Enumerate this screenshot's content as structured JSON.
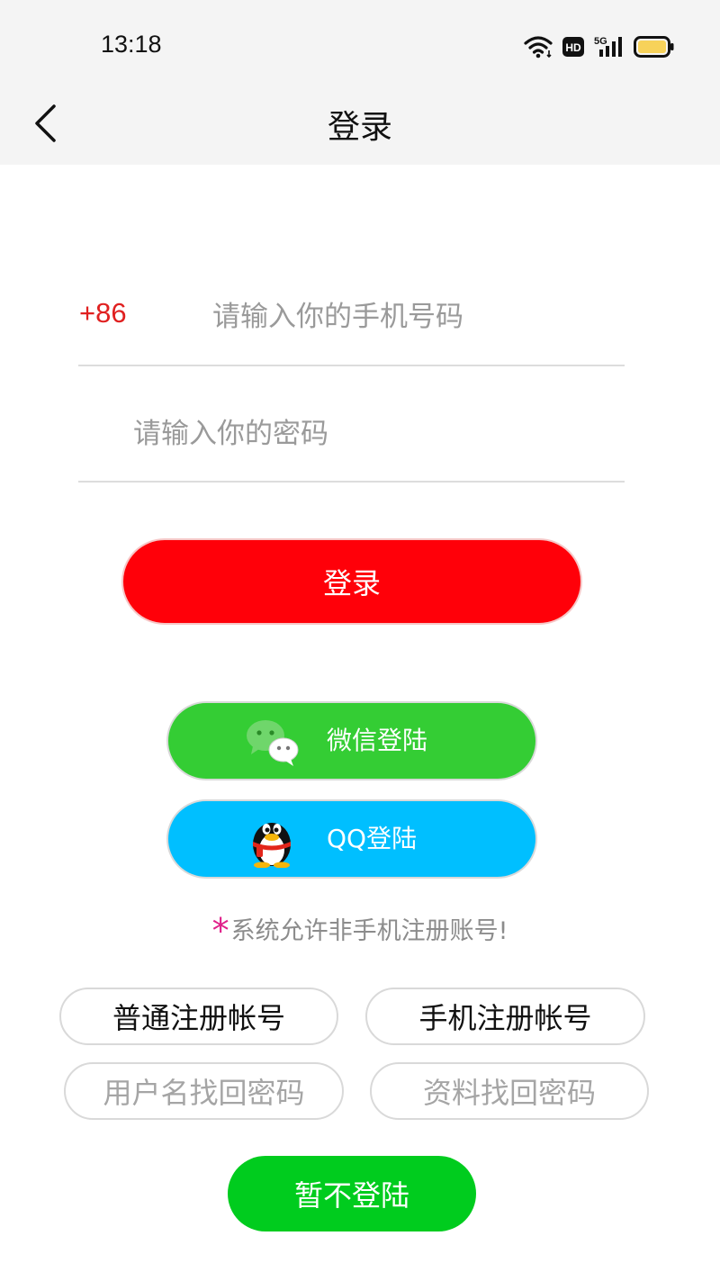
{
  "status_bar": {
    "time": "13:18",
    "hd_label": "HD",
    "network_label": "5G",
    "icons": [
      "wifi-icon",
      "hd-icon",
      "signal-5g-icon",
      "battery-icon"
    ],
    "battery_color": "#f7d25a"
  },
  "nav": {
    "title": "登录",
    "back_icon": "chevron-left-icon"
  },
  "form": {
    "phone_prefix": "+86",
    "phone_placeholder": "请输入你的手机号码",
    "phone_value": "",
    "password_placeholder": "请输入你的密码",
    "password_value": "",
    "login_label": "登录"
  },
  "social": {
    "wechat_label": "微信登陆",
    "qq_label": "QQ登陆"
  },
  "notice": {
    "star": "*",
    "text": "系统允许非手机注册账号!"
  },
  "links": {
    "normal_register": "普通注册帐号",
    "phone_register": "手机注册帐号",
    "username_recover": "用户名找回密码",
    "profile_recover": "资料找回密码"
  },
  "skip_label": "暂不登陆",
  "colors": {
    "login_button": "#ff0009",
    "wechat_button": "#34cd34",
    "qq_button": "#00bfff",
    "skip_button": "#00cc1e",
    "prefix_text": "#e02020",
    "notice_star": "#e0208a"
  }
}
